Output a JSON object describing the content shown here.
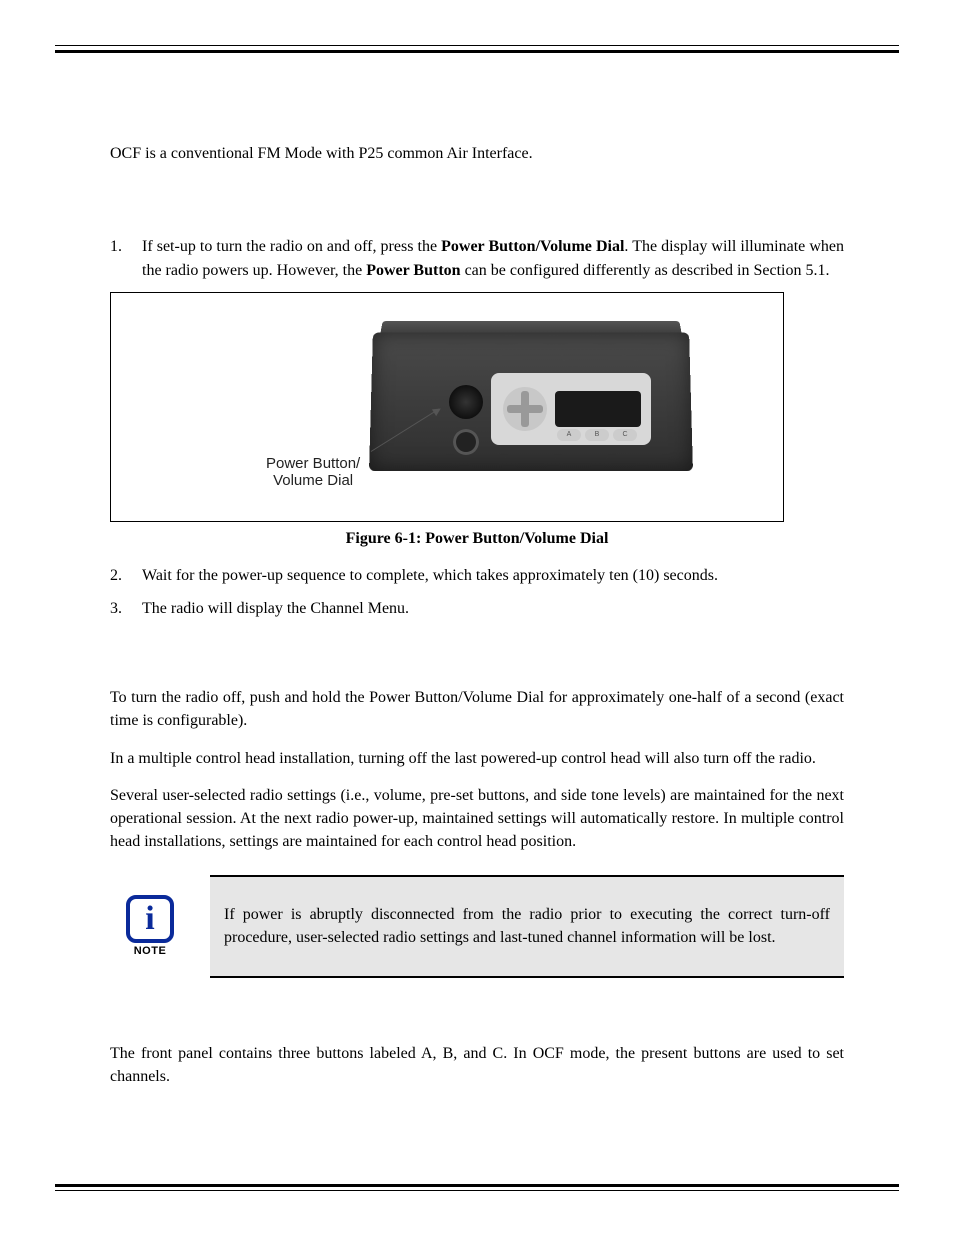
{
  "intro": "OCF is a conventional FM Mode with P25 common Air Interface.",
  "steps": {
    "s1_a": "If set-up to turn the radio on and off, press the ",
    "s1_b": "Power Button/Volume Dial",
    "s1_c": ". The display will illuminate when the radio powers up. However, the ",
    "s1_d": "Power Button",
    "s1_e": " can be configured differently as described in Section 5.1.",
    "s2": "Wait for the power-up sequence to complete, which takes approximately ten (10) seconds.",
    "s3": "The radio will display the Channel Menu."
  },
  "nums": {
    "n1": "1.",
    "n2": "2.",
    "n3": "3."
  },
  "figure": {
    "callout_line1": "Power Button/",
    "callout_line2": "Volume Dial",
    "caption": "Figure 6-1: Power Button/Volume Dial",
    "btnA": "A",
    "btnB": "B",
    "btnC": "C"
  },
  "turnoff": {
    "p1": "To turn the radio off, push and hold the Power Button/Volume Dial for approximately one-half of a second (exact time is configurable).",
    "p2": "In a multiple control head installation, turning off the last powered-up control head will also turn off the radio.",
    "p3": "Several user-selected radio settings (i.e., volume, pre-set buttons, and side tone levels) are maintained for the next operational session. At the next radio power-up, maintained settings will automatically restore. In multiple control head installations, settings are maintained for each control head position."
  },
  "note": {
    "glyph": "i",
    "label": "NOTE",
    "text": "If power is abruptly disconnected from the radio prior to executing the correct turn-off procedure, user-selected radio settings and last-tuned channel information will be lost."
  },
  "preset": "The front panel contains three buttons labeled A, B, and C. In OCF mode, the present buttons are used to set channels."
}
